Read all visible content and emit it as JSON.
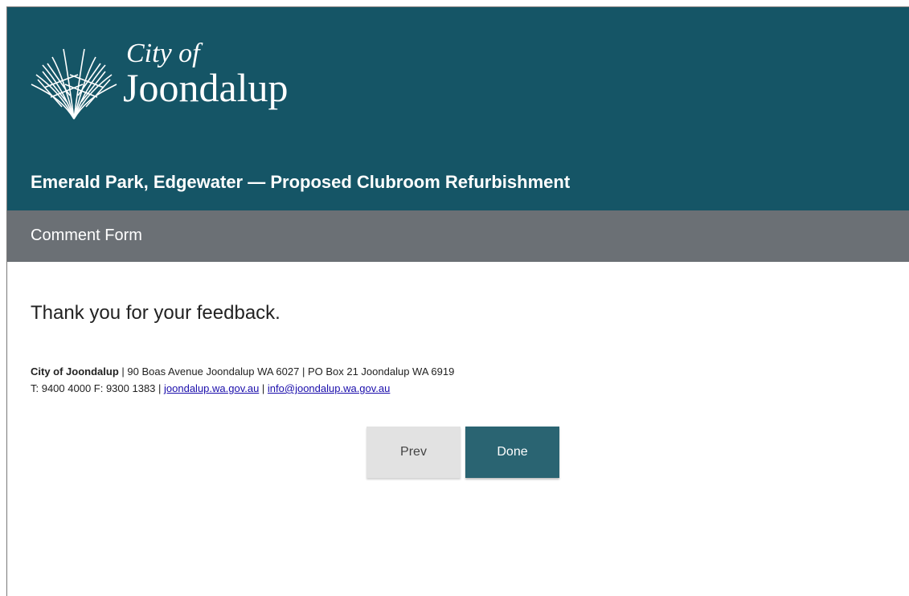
{
  "header": {
    "logo_line1": "City of",
    "logo_line2": "Joondalup",
    "logo_icon": "fan-leaf-logo-icon",
    "project_title": "Emerald Park, Edgewater — Proposed Clubroom Refurbishment",
    "background_color": "#155566"
  },
  "subheader": {
    "title": "Comment Form",
    "background_color": "#6b7075"
  },
  "main": {
    "thanks_message": "Thank you for your feedback."
  },
  "footer": {
    "org_name": "City of Joondalup",
    "separator1": " | ",
    "address": "90 Boas Avenue Joondalup WA 6027",
    "separator2": " | ",
    "po_box": "PO Box 21 Joondalup WA 6919",
    "phone_fax": "T: 9400 4000 F: 9300 1383",
    "separator3": " | ",
    "website_link": "joondalup.wa.gov.au",
    "separator4": " | ",
    "email_link": "info@joondalup.wa.gov.au",
    "link_color": "#1a0dab"
  },
  "navigation": {
    "prev_label": "Prev",
    "done_label": "Done",
    "done_color": "#2a6472"
  }
}
